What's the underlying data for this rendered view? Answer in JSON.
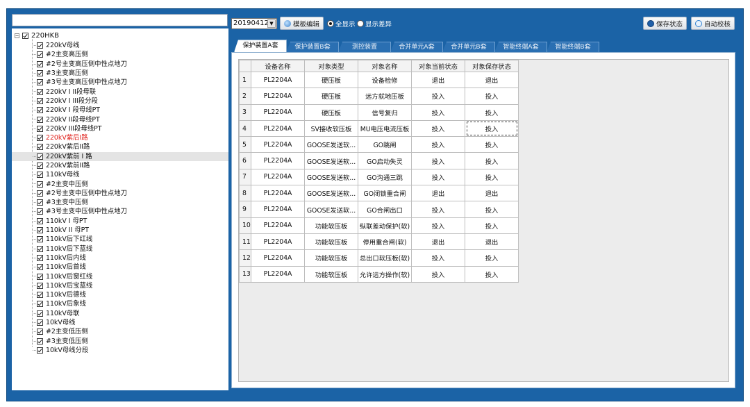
{
  "tree": {
    "root": "220HKB",
    "items": [
      {
        "label": "220kV母线"
      },
      {
        "label": "#2主变高压侧"
      },
      {
        "label": "#2号主变高压侧中性点地刀"
      },
      {
        "label": "#3主变高压侧"
      },
      {
        "label": "#3号主变高压侧中性点地刀"
      },
      {
        "label": "220kV I II段母联"
      },
      {
        "label": "220kV I III段分段"
      },
      {
        "label": "220kV I 段母线PT"
      },
      {
        "label": "220kV II段母线PT"
      },
      {
        "label": "220kV III段母线PT"
      },
      {
        "label": "220kV紫后I路",
        "red": true
      },
      {
        "label": "220kV紫后II路"
      },
      {
        "label": "220kV紫前 I 路",
        "hl": true
      },
      {
        "label": "220kV紫前II路"
      },
      {
        "label": "110kV母线"
      },
      {
        "label": "#2主变中压侧"
      },
      {
        "label": "#2号主变中压侧中性点地刀"
      },
      {
        "label": "#3主变中压侧"
      },
      {
        "label": "#3号主变中压侧中性点地刀"
      },
      {
        "label": "110kV I 母PT"
      },
      {
        "label": "110kV II 母PT"
      },
      {
        "label": "110kV后下红线"
      },
      {
        "label": "110kV后下蓝线"
      },
      {
        "label": "110kV后内线"
      },
      {
        "label": "110kV后首线"
      },
      {
        "label": "110kV后窗红线"
      },
      {
        "label": "110kV后宝蓝线"
      },
      {
        "label": "110kV后德线"
      },
      {
        "label": "110kV后象线"
      },
      {
        "label": "110kV母联"
      },
      {
        "label": "10kV母线"
      },
      {
        "label": "#2主变低压侧"
      },
      {
        "label": "#3主变低压侧"
      },
      {
        "label": "10kV母线分段"
      }
    ]
  },
  "toolbar": {
    "date": "20190412",
    "template_edit": "模板编辑",
    "radio_all": "全显示",
    "radio_diff": "显示差异",
    "save_state": "保存状态",
    "auto_check": "自动校核"
  },
  "tabs": [
    {
      "label": "保护装置A套",
      "active": true
    },
    {
      "label": "保护装置B套"
    },
    {
      "label": "测控装置"
    },
    {
      "label": "合并单元A套"
    },
    {
      "label": "合并单元B套"
    },
    {
      "label": "智能终端A套"
    },
    {
      "label": "智能终端B套"
    }
  ],
  "grid": {
    "columns": [
      "设备名称",
      "对象类型",
      "对象名称",
      "对象当前状态",
      "对象保存状态"
    ],
    "rows": [
      [
        "1",
        "PL2204A",
        "硬压板",
        "设备检修",
        "退出",
        "退出"
      ],
      [
        "2",
        "PL2204A",
        "硬压板",
        "远方就地压板",
        "投入",
        "投入"
      ],
      [
        "3",
        "PL2204A",
        "硬压板",
        "信号复归",
        "投入",
        "投入"
      ],
      [
        "4",
        "PL2204A",
        "SV接收软压板",
        "MU电压电流压板",
        "投入",
        "投入"
      ],
      [
        "5",
        "PL2204A",
        "GOOSE发送软...",
        "GO跳闸",
        "投入",
        "投入"
      ],
      [
        "6",
        "PL2204A",
        "GOOSE发送软...",
        "GO启动失灵",
        "投入",
        "投入"
      ],
      [
        "7",
        "PL2204A",
        "GOOSE发送软...",
        "GO沟通三跳",
        "投入",
        "投入"
      ],
      [
        "8",
        "PL2204A",
        "GOOSE发送软...",
        "GO闭锁重合闸",
        "退出",
        "退出"
      ],
      [
        "9",
        "PL2204A",
        "GOOSE发送软...",
        "GO合闸出口",
        "投入",
        "投入"
      ],
      [
        "10",
        "PL2204A",
        "功能软压板",
        "纵联差动保护(软)",
        "投入",
        "投入"
      ],
      [
        "11",
        "PL2204A",
        "功能软压板",
        "停用重合闸(软)",
        "退出",
        "退出"
      ],
      [
        "12",
        "PL2204A",
        "功能软压板",
        "总出口软压板(软)",
        "投入",
        "投入"
      ],
      [
        "13",
        "PL2204A",
        "功能软压板",
        "允许远方操作(软)",
        "投入",
        "投入"
      ]
    ]
  },
  "colors": {
    "frame_blue": "#1b63a6",
    "alert_red": "#e0201a",
    "save_icon": "#1f5fa8",
    "search_icon": "#2e7fd0"
  },
  "icons": {
    "template_edit": "edit-icon",
    "save_state": "save-icon",
    "auto_check": "search-icon",
    "date_dropdown": "chevron-down-icon"
  }
}
